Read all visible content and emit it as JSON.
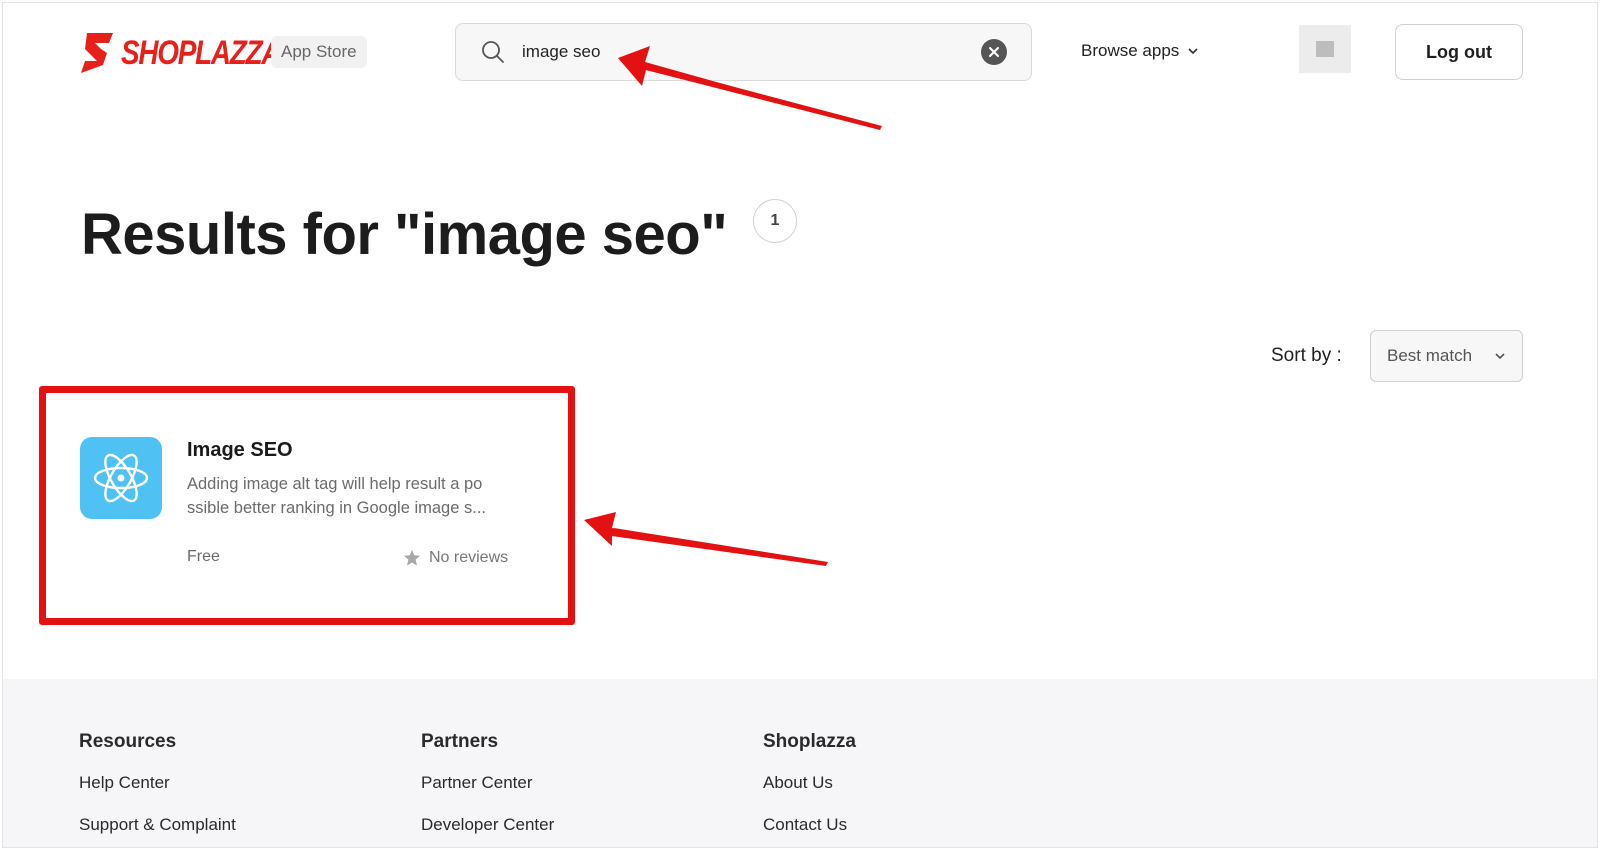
{
  "header": {
    "brand": "SHOPLAZZA",
    "store_label": "App Store",
    "search": {
      "value": "image seo"
    },
    "browse_label": "Browse apps",
    "logout_label": "Log out"
  },
  "results": {
    "title": "Results for \"image seo\"",
    "count": "1"
  },
  "sort": {
    "label": "Sort by :",
    "selected": "Best match"
  },
  "apps": [
    {
      "name": "Image SEO",
      "description": "Adding image alt tag will help result a po ssible better ranking in Google image s...",
      "price": "Free",
      "reviews": "No reviews"
    }
  ],
  "footer": {
    "columns": [
      {
        "heading": "Resources",
        "links": [
          "Help Center",
          "Support & Complaint"
        ]
      },
      {
        "heading": "Partners",
        "links": [
          "Partner Center",
          "Developer Center"
        ]
      },
      {
        "heading": "Shoplazza",
        "links": [
          "About Us",
          "Contact Us"
        ]
      }
    ]
  },
  "colors": {
    "brand": "#e8201c",
    "annotation": "#e31111",
    "app_icon": "#4fc1f2"
  },
  "icons": [
    "shoplazza-logo-icon",
    "search-icon",
    "clear-icon",
    "chevron-down-icon",
    "atom-icon",
    "star-icon"
  ]
}
